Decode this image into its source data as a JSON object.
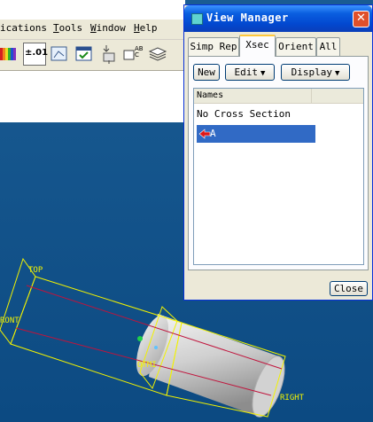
{
  "menubar": {
    "items": [
      {
        "label": "ications",
        "underline": ""
      },
      {
        "label": "Tools",
        "underline": "T"
      },
      {
        "label": "Window",
        "underline": "W"
      },
      {
        "label": "Help",
        "underline": "H"
      }
    ]
  },
  "toolbar": {
    "precision_label": "±.01",
    "buttons": [
      "color-palette-icon",
      "precision-icon",
      "display-style-icon",
      "check-icon",
      "add-component-icon",
      "annotation-icon",
      "layers-icon"
    ]
  },
  "dialog": {
    "title": "View Manager",
    "close_glyph": "✕",
    "tabs": [
      "Simp Rep",
      "Xsec",
      "Orient",
      "All"
    ],
    "active_tab": "Xsec",
    "buttons": {
      "new": "New",
      "edit": "Edit",
      "display": "Display"
    },
    "list": {
      "header": "Names",
      "rows": [
        "No Cross Section",
        "A"
      ],
      "selected": "A"
    },
    "close_button": "Close"
  },
  "viewport": {
    "labels": {
      "top": "TOP",
      "front": "RONT",
      "bottom": "OTMI",
      "right": "RIGHT"
    },
    "colors": {
      "background": "#0d4f86",
      "datum": "#f2f200",
      "axis": "#c0143c",
      "cylinder": "#d8d8d8"
    }
  }
}
